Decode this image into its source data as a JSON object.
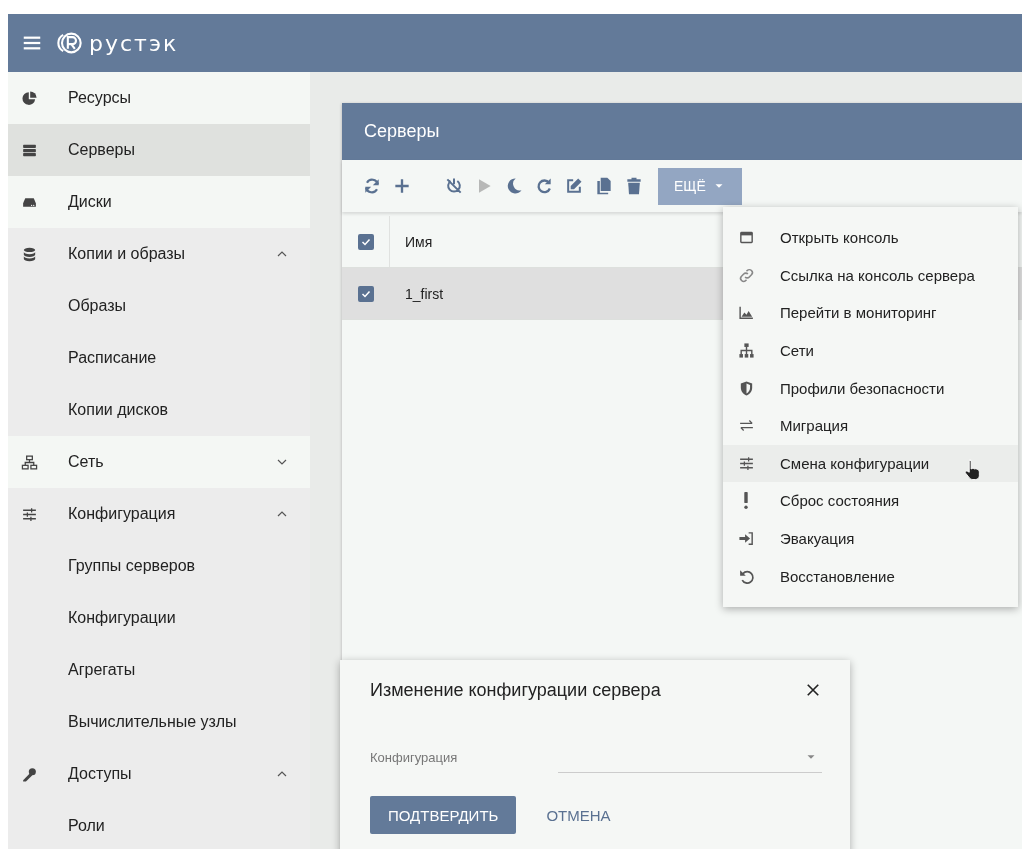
{
  "header": {
    "brand": "рустэк"
  },
  "sidebar": {
    "items": [
      {
        "label": "Ресурсы",
        "selected": false
      },
      {
        "label": "Серверы",
        "selected": true
      },
      {
        "label": "Диски",
        "selected": false
      },
      {
        "label": "Копии и образы",
        "selected": false,
        "expanded": true,
        "children": [
          {
            "label": "Образы",
            "selected": false
          },
          {
            "label": "Расписание",
            "selected": false
          },
          {
            "label": "Копии дисков",
            "selected": false
          }
        ]
      },
      {
        "label": "Сеть",
        "selected": false,
        "expanded": false
      },
      {
        "label": "Конфигурация",
        "selected": false,
        "expanded": true,
        "children": [
          {
            "label": "Группы серверов",
            "selected": false
          },
          {
            "label": "Конфигурации",
            "selected": false
          },
          {
            "label": "Агрегаты",
            "selected": false
          },
          {
            "label": "Вычислительные узлы",
            "selected": false
          }
        ]
      },
      {
        "label": "Доступы",
        "selected": false,
        "expanded": true,
        "children": [
          {
            "label": "Роли",
            "selected": false
          }
        ]
      }
    ]
  },
  "panel": {
    "title": "Серверы",
    "toolbar": [
      {
        "disabled": false
      },
      {
        "disabled": false
      },
      {
        "disabled": false
      },
      {
        "disabled": true
      },
      {
        "disabled": false
      },
      {
        "disabled": false
      },
      {
        "disabled": false
      },
      {
        "disabled": false
      },
      {
        "disabled": false
      }
    ],
    "more_button": {
      "label": "ЕЩЁ",
      "expanded": true
    },
    "table": {
      "all_checked": true,
      "columns": [
        "Имя"
      ],
      "rows": [
        {
          "cells": [
            "1_first"
          ],
          "checked": true,
          "selected": true
        }
      ]
    }
  },
  "menu": {
    "items": [
      {
        "label": "Открыть консоль",
        "selected": false
      },
      {
        "label": "Ссылка на консоль сервера",
        "selected": false
      },
      {
        "label": "Перейти в мониторинг",
        "selected": false
      },
      {
        "label": "Сети",
        "selected": false
      },
      {
        "label": "Профили безопасности",
        "selected": false
      },
      {
        "label": "Миграция",
        "selected": false
      },
      {
        "label": "Смена конфигурации",
        "selected": true
      },
      {
        "label": "Сброс состояния",
        "selected": false
      },
      {
        "label": "Эвакуация",
        "selected": false
      },
      {
        "label": "Восстановление",
        "selected": false
      }
    ]
  },
  "dialog": {
    "title": "Изменение конфигурации сервера",
    "field": {
      "label": "Конфигурация"
    },
    "buttons": [
      {
        "label": "ПОДТВЕРДИТЬ",
        "kind": "primary"
      },
      {
        "label": "ОТМЕНА",
        "kind": "text"
      }
    ]
  }
}
